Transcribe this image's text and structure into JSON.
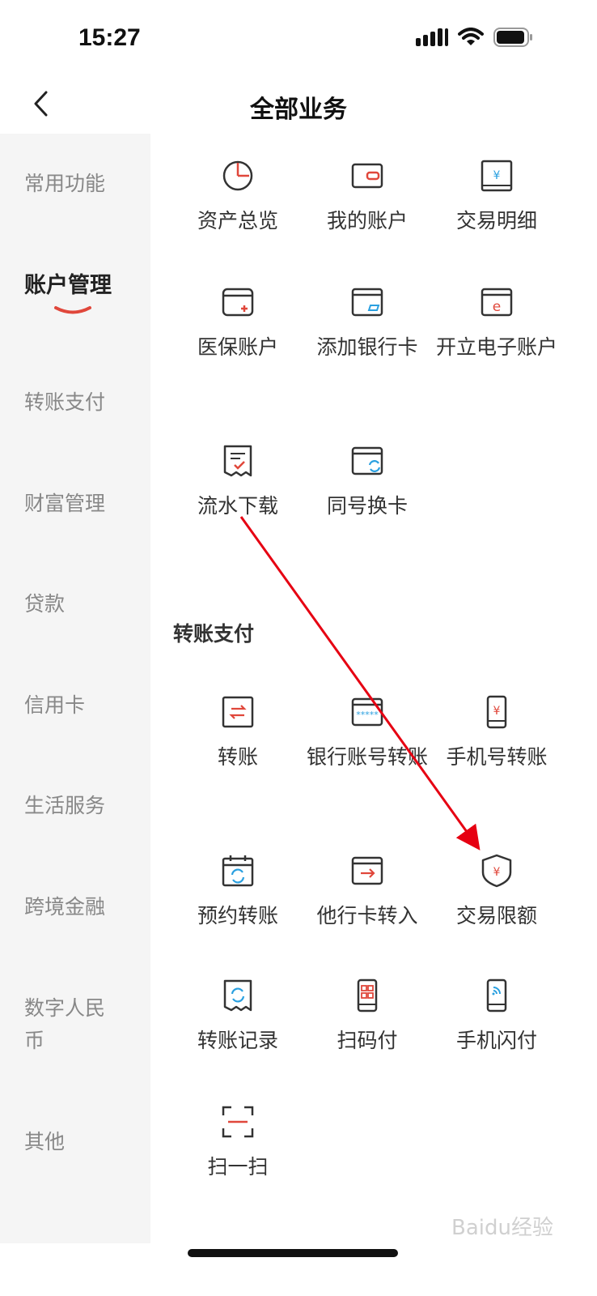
{
  "status": {
    "time": "15:27"
  },
  "header": {
    "title": "全部业务"
  },
  "sidebar": {
    "items": [
      {
        "label": "常用功能"
      },
      {
        "label": "账户管理"
      },
      {
        "label": "转账支付"
      },
      {
        "label": "财富管理"
      },
      {
        "label": "贷款"
      },
      {
        "label": "信用卡"
      },
      {
        "label": "生活服务"
      },
      {
        "label": "跨境金融"
      },
      {
        "label": "数字人民币"
      },
      {
        "label": "其他"
      }
    ],
    "active_index": 1
  },
  "sections": {
    "account": {
      "items": [
        {
          "label": "资产总览",
          "icon": "clock-pie-icon"
        },
        {
          "label": "我的账户",
          "icon": "wallet-icon"
        },
        {
          "label": "交易明细",
          "icon": "yuan-bill-icon"
        },
        {
          "label": "医保账户",
          "icon": "medical-card-icon"
        },
        {
          "label": "添加银行卡",
          "icon": "add-card-icon"
        },
        {
          "label": "开立电子账户",
          "icon": "e-account-icon"
        },
        {
          "label": "流水下载",
          "icon": "receipt-check-icon"
        },
        {
          "label": "同号换卡",
          "icon": "card-refresh-icon"
        }
      ]
    },
    "transfer": {
      "title": "转账支付",
      "items": [
        {
          "label": "转账",
          "icon": "transfer-icon"
        },
        {
          "label": "银行账号转账",
          "icon": "bank-card-password-icon"
        },
        {
          "label": "手机号转账",
          "icon": "phone-yuan-icon"
        },
        {
          "label": "预约转账",
          "icon": "calendar-refresh-icon"
        },
        {
          "label": "他行卡转入",
          "icon": "card-arrow-icon"
        },
        {
          "label": "交易限额",
          "icon": "shield-yuan-icon"
        },
        {
          "label": "转账记录",
          "icon": "receipt-refresh-icon"
        },
        {
          "label": "扫码付",
          "icon": "phone-qr-icon"
        },
        {
          "label": "手机闪付",
          "icon": "phone-nfc-icon"
        },
        {
          "label": "扫一扫",
          "icon": "scan-icon"
        }
      ]
    }
  },
  "colors": {
    "accent": "#e0473b",
    "blue": "#2aa0e0",
    "sidebar_bg": "#f5f5f5"
  }
}
